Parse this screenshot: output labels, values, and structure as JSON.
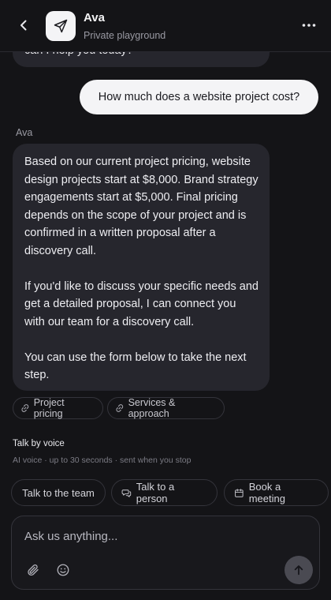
{
  "header": {
    "title": "Ava",
    "subtitle": "Private playground",
    "back_icon": "chevron-left-icon",
    "avatar_icon": "paper-plane-icon",
    "more_icon": "more-horizontal-icon"
  },
  "messages": {
    "previous_bot_fragment": "can I help you today?",
    "user_message": "How much does a website project cost?",
    "bot_sender": "Ava",
    "bot_paragraphs": [
      "Based on our current project pricing, website design projects start at $8,000. Brand strategy engagements start at $5,000. Final pricing depends on the scope of your project and is confirmed in a written proposal after a discovery call.",
      "If you'd like to discuss your specific needs and get a detailed proposal, I can connect you with our team for a discovery call.",
      "You can use the form below to take the next step."
    ]
  },
  "source_chips": [
    {
      "label": "Project pricing",
      "icon": "link-icon"
    },
    {
      "label": "Services & approach",
      "icon": "link-icon"
    }
  ],
  "voice": {
    "title": "Talk by voice",
    "subtitle": "AI voice · up to 30 seconds · sent when you stop"
  },
  "actions": [
    {
      "label": "Talk to the team",
      "icon": ""
    },
    {
      "label": "Talk to a person",
      "icon": "chat-bubbles-icon"
    },
    {
      "label": "Book a meeting",
      "icon": "calendar-icon"
    }
  ],
  "composer": {
    "placeholder": "Ask us anything...",
    "attach_icon": "paperclip-icon",
    "emoji_icon": "smiley-icon",
    "send_icon": "arrow-up-icon"
  },
  "colors": {
    "background": "#141417",
    "bubble_bot": "#26262d",
    "bubble_user": "#f4f4f6",
    "border": "#34343b"
  }
}
